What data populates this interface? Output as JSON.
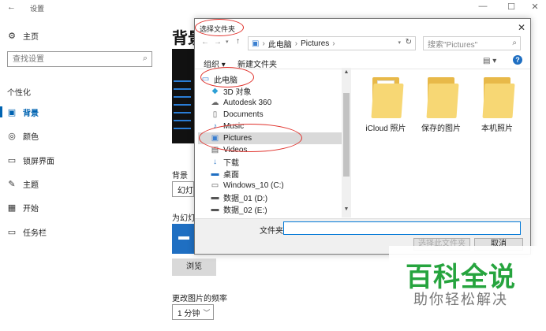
{
  "settings": {
    "window_title": "设置",
    "home": "主页",
    "search_placeholder": "查找设置",
    "section": "个性化",
    "items": [
      "背景",
      "颜色",
      "锁屏界面",
      "主题",
      "开始",
      "任务栏"
    ],
    "main_heading": "背景",
    "background_label": "背景",
    "background_value": "幻灯",
    "album_label": "为幻灯",
    "browse_button": "浏览",
    "frequency_label": "更改图片的频率",
    "frequency_value": "1 分钟"
  },
  "dialog": {
    "title": "选择文件夹",
    "path": [
      "此电脑",
      "Pictures"
    ],
    "search_placeholder": "搜索\"Pictures\"",
    "organize": "组织 ▾",
    "new_folder": "新建文件夹",
    "nav_items": [
      "此电脑",
      "3D 对象",
      "Autodesk 360",
      "Documents",
      "Music",
      "Pictures",
      "Videos",
      "下载",
      "桌面",
      "Windows_10 (C:)",
      "数据_01 (D:)",
      "数据_02 (E:)"
    ],
    "folders": [
      "iCloud 照片",
      "保存的图片",
      "本机照片"
    ],
    "folder_label": "文件夹:",
    "select_button": "选择此文件夹",
    "cancel_button": "取消"
  },
  "watermark": {
    "big": "百科全说",
    "small": "助你轻松解决"
  },
  "colors": {
    "accent": "#0063b1",
    "annotation": "#e0302a",
    "watermark": "#26a43e"
  }
}
